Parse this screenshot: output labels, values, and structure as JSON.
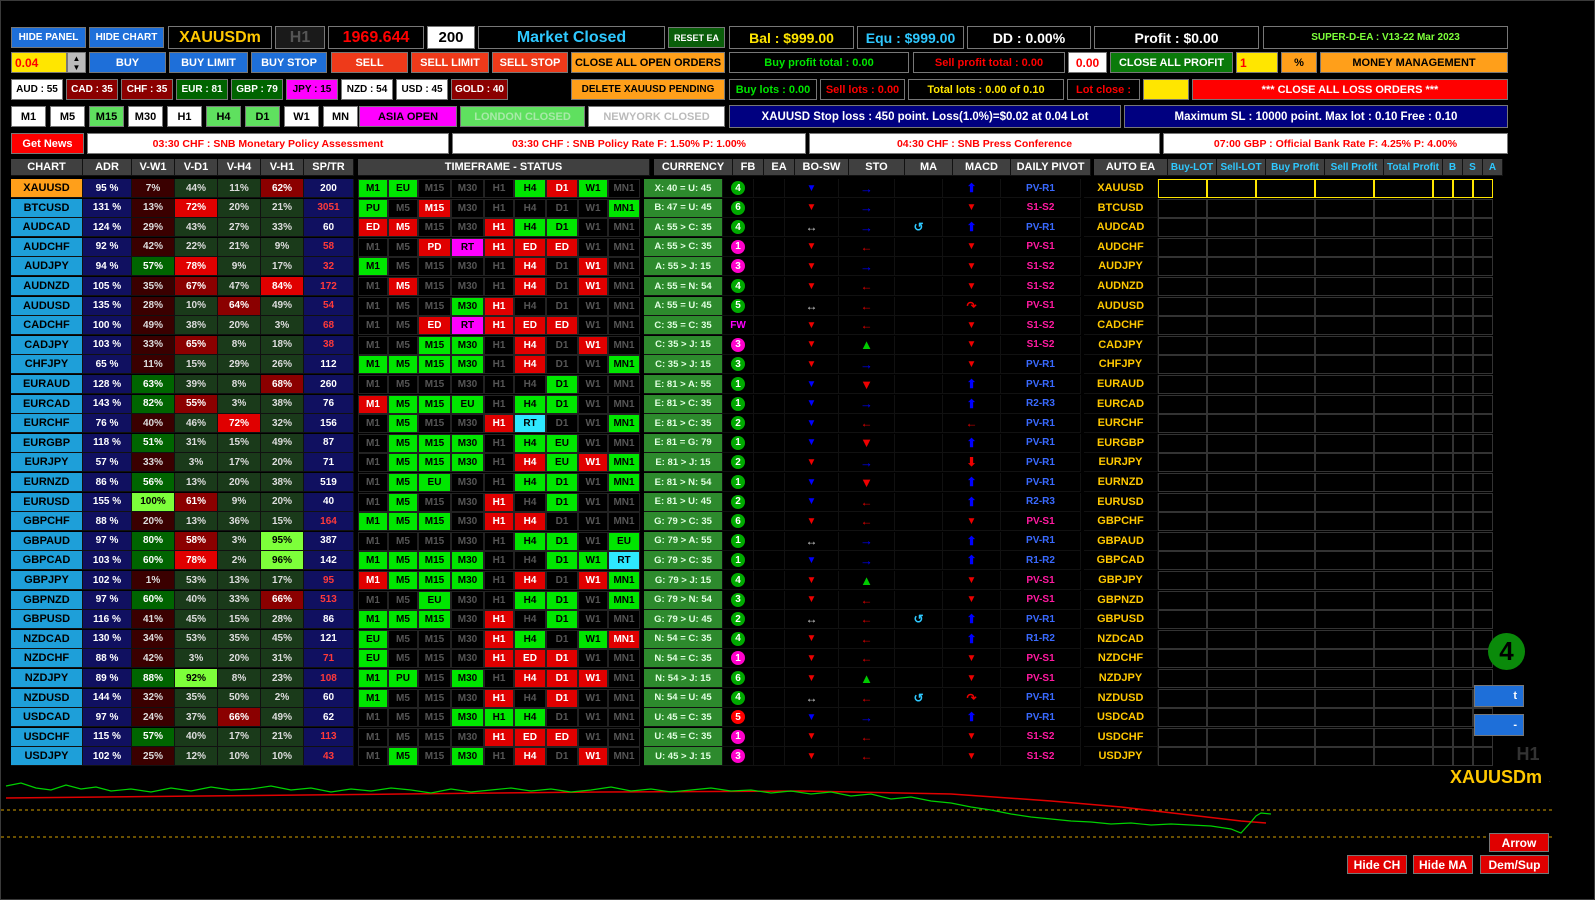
{
  "top": {
    "hide_panel": "HIDE PANEL",
    "hide_chart": "HIDE CHART",
    "symbol": "XAUUSDm",
    "timeframe": "H1",
    "price": "1969.644",
    "bars": "200",
    "market_status": "Market Closed",
    "reset_ea": "RESET EA",
    "balance": "Bal : $999.00",
    "equity": "Equ : $999.00",
    "drawdown": "DD : 0.00%",
    "profit": "Profit : $0.00",
    "version": "SUPER-D-EA : V13-22 Mar 2023"
  },
  "trade": {
    "lot_value": "0.04",
    "buy": "BUY",
    "buy_limit": "BUY LIMIT",
    "buy_stop": "BUY STOP",
    "sell": "SELL",
    "sell_limit": "SELL LIMIT",
    "sell_stop": "SELL STOP",
    "close_all_open": "CLOSE ALL OPEN ORDERS",
    "buy_profit_total": "Buy profit total : 0.00",
    "sell_profit_total": "Sell profit total : 0.00",
    "profit_value": "0.00",
    "close_all_profit": "CLOSE ALL PROFIT",
    "percent_value": "1",
    "percent_label": "%",
    "money_management": "MONEY MANAGEMENT"
  },
  "strength": [
    {
      "label": "AUD : 55",
      "bg": "#ffffff",
      "fg": "#000000"
    },
    {
      "label": "CAD : 35",
      "bg": "#8b0000",
      "fg": "#ffffff"
    },
    {
      "label": "CHF : 35",
      "bg": "#8b0000",
      "fg": "#ffffff"
    },
    {
      "label": "EUR : 81",
      "bg": "#006400",
      "fg": "#ffffff"
    },
    {
      "label": "GBP : 79",
      "bg": "#006400",
      "fg": "#ffffff"
    },
    {
      "label": "JPY : 15",
      "bg": "#ff00ff",
      "fg": "#000000"
    },
    {
      "label": "NZD : 54",
      "bg": "#ffffff",
      "fg": "#000000"
    },
    {
      "label": "USD : 45",
      "bg": "#ffffff",
      "fg": "#000000"
    },
    {
      "label": "GOLD : 40",
      "bg": "#8b0000",
      "fg": "#ffffff"
    }
  ],
  "row3": {
    "delete_pending": "DELETE XAUUSD PENDING",
    "buy_lots": "Buy lots : 0.00",
    "sell_lots": "Sell lots : 0.00",
    "total_lots": "Total lots : 0.00 of 0.10",
    "lot_close": "Lot close :",
    "close_all_loss": "*** CLOSE ALL LOSS ORDERS ***"
  },
  "tf_buttons": [
    "M1",
    "M5",
    "M15",
    "M30",
    "H1",
    "H4",
    "D1",
    "W1",
    "MN"
  ],
  "sessions": {
    "asia": "ASIA OPEN",
    "london": "LONDON CLOSED",
    "newyork": "NEWYORK CLOSED"
  },
  "info": {
    "stop_loss": "XAUUSD Stop loss : 450 point. Loss(1.0%)=$0.02 at 0.04 Lot",
    "max_sl": "Maximum SL : 10000 point. Max lot : 0.10 Free : 0.10"
  },
  "news": {
    "button": "Get News",
    "items": [
      "03:30 CHF : SNB Monetary Policy Assessment",
      "03:30 CHF : SNB Policy Rate  F: 1.50% P: 1.00%",
      "04:30 CHF : SNB Press Conference",
      "07:00 GBP : Official Bank Rate  F: 4.25% P: 4.00%"
    ]
  },
  "headers": {
    "chart": "CHART",
    "adr": "ADR",
    "vw1": "V-W1",
    "vd1": "V-D1",
    "vh4": "V-H4",
    "vh1": "V-H1",
    "sptr": "SP/TR",
    "tfstatus": "TIMEFRAME -  STATUS",
    "currency": "CURRENCY",
    "fb": "FB",
    "ea": "EA",
    "bosw": "BO-SW",
    "sto": "STO",
    "ma": "MA",
    "macd": "MACD",
    "pivot": "DAILY PIVOT",
    "autoea": "AUTO EA",
    "buylot": "Buy-LOT",
    "selllot": "Sell-LOT",
    "buyprofit": "Buy Profit",
    "sellprofit": "Sell Profit",
    "totalprofit": "Total Profit",
    "b": "B",
    "s": "S",
    "a": "A"
  },
  "tf_names": [
    "M1",
    "M5",
    "M15",
    "M30",
    "H1",
    "H4",
    "D1",
    "W1",
    "MN1"
  ],
  "rows": [
    {
      "sym": "XAUUSD",
      "adr": "95 %",
      "vw1": "7%",
      "vd1": "44%",
      "vh4": "11%",
      "vh1": "62%",
      "sp": "200",
      "tf": [
        "g",
        "EU",
        "x",
        "x",
        "x",
        "g",
        "r",
        "g",
        "x"
      ],
      "cur": "X: 40 = U: 45",
      "fb": "4",
      "fbc": "#0a0",
      "bo": "dot",
      "sto": "rb",
      "ma": "",
      "macd": "ub",
      "piv": "PV-R1",
      "pc": "#00f"
    },
    {
      "sym": "BTCUSD",
      "adr": "131 %",
      "vw1": "13%",
      "vd1": "72%",
      "vh4": "20%",
      "vh1": "21%",
      "sp": "3051",
      "tf": [
        "PU",
        "x",
        "r",
        "x",
        "x",
        "x",
        "x",
        "x",
        "g"
      ],
      "cur": "B: 47 = U: 45",
      "fb": "6",
      "fbc": "#0a0",
      "bo": "dr",
      "sto": "rb",
      "ma": "",
      "macd": "dr",
      "piv": "S1-S2",
      "pc": "#f0c"
    },
    {
      "sym": "AUDCAD",
      "adr": "124 %",
      "vw1": "29%",
      "vd1": "43%",
      "vh4": "27%",
      "vh1": "33%",
      "sp": "60",
      "tf": [
        "ED",
        "r",
        "x",
        "x",
        "r",
        "g",
        "g",
        "x",
        "x"
      ],
      "cur": "A: 55 > C: 35",
      "fb": "4",
      "fbc": "#0a0",
      "bo": "lr",
      "sto": "rb",
      "ma": "u",
      "macd": "ub",
      "piv": "PV-R1",
      "pc": "#00f"
    },
    {
      "sym": "AUDCHF",
      "adr": "92 %",
      "vw1": "42%",
      "vd1": "22%",
      "vh4": "21%",
      "vh1": "9%",
      "sp": "58",
      "tf": [
        "x",
        "x",
        "PD",
        "RT",
        "r",
        "ED",
        "ED",
        "x",
        "x"
      ],
      "cur": "A: 55 > C: 35",
      "fb": "1",
      "fbc": "#f0c",
      "bo": "dr",
      "sto": "lr",
      "ma": "",
      "macd": "dr",
      "piv": "PV-S1",
      "pc": "#f0c"
    },
    {
      "sym": "AUDJPY",
      "adr": "94 %",
      "vw1": "57%",
      "vd1": "78%",
      "vh4": "9%",
      "vh1": "17%",
      "sp": "32",
      "tf": [
        "g",
        "x",
        "x",
        "x",
        "x",
        "r",
        "x",
        "r",
        "x"
      ],
      "cur": "A: 55 > J: 15",
      "fb": "3",
      "fbc": "#f0c",
      "bo": "dr",
      "sto": "rb",
      "ma": "",
      "macd": "dr",
      "piv": "S1-S2",
      "pc": "#f0c"
    },
    {
      "sym": "AUDNZD",
      "adr": "105 %",
      "vw1": "35%",
      "vd1": "67%",
      "vh4": "47%",
      "vh1": "84%",
      "sp": "172",
      "tf": [
        "x",
        "r",
        "x",
        "x",
        "x",
        "r",
        "x",
        "r",
        "x"
      ],
      "cur": "A: 55 = N: 54",
      "fb": "4",
      "fbc": "#0a0",
      "bo": "dr",
      "sto": "lr",
      "ma": "",
      "macd": "dr",
      "piv": "S1-S2",
      "pc": "#f0c"
    },
    {
      "sym": "AUDUSD",
      "adr": "135 %",
      "vw1": "28%",
      "vd1": "10%",
      "vh4": "64%",
      "vh1": "49%",
      "sp": "54",
      "tf": [
        "x",
        "x",
        "x",
        "g",
        "r",
        "x",
        "x",
        "x",
        "x"
      ],
      "cur": "A: 55 = U: 45",
      "fb": "5",
      "fbc": "#0a0",
      "bo": "lr",
      "sto": "lr",
      "ma": "",
      "macd": "ar",
      "piv": "PV-S1",
      "pc": "#f0c"
    },
    {
      "sym": "CADCHF",
      "adr": "100 %",
      "vw1": "49%",
      "vd1": "38%",
      "vh4": "20%",
      "vh1": "3%",
      "sp": "68",
      "tf": [
        "x",
        "x",
        "ED",
        "RT",
        "r",
        "ED",
        "ED",
        "x",
        "x"
      ],
      "cur": "C: 35 = C: 35",
      "fb": "FW",
      "fbc": "",
      "bo": "dr",
      "sto": "lr",
      "ma": "",
      "macd": "dr",
      "piv": "S1-S2",
      "pc": "#f0c"
    },
    {
      "sym": "CADJPY",
      "adr": "103 %",
      "vw1": "33%",
      "vd1": "65%",
      "vh4": "8%",
      "vh1": "18%",
      "sp": "38",
      "tf": [
        "x",
        "x",
        "g",
        "g",
        "x",
        "r",
        "x",
        "r",
        "x"
      ],
      "cur": "C: 35 > J: 15",
      "fb": "3",
      "fbc": "#f0c",
      "bo": "dr",
      "sto": "tg",
      "ma": "",
      "macd": "dr",
      "piv": "S1-S2",
      "pc": "#f0c"
    },
    {
      "sym": "CHFJPY",
      "adr": "65 %",
      "vw1": "11%",
      "vd1": "15%",
      "vh4": "29%",
      "vh1": "26%",
      "sp": "112",
      "tf": [
        "g",
        "g",
        "g",
        "g",
        "x",
        "r",
        "x",
        "x",
        "g"
      ],
      "cur": "C: 35 > J: 15",
      "fb": "3",
      "fbc": "#0a0",
      "bo": "dr",
      "sto": "rb",
      "ma": "",
      "macd": "dr",
      "piv": "PV-R1",
      "pc": "#00f"
    },
    {
      "sym": "EURAUD",
      "adr": "128 %",
      "vw1": "63%",
      "vd1": "39%",
      "vh4": "8%",
      "vh1": "68%",
      "sp": "260",
      "tf": [
        "x",
        "x",
        "x",
        "x",
        "x",
        "x",
        "g",
        "x",
        "x"
      ],
      "cur": "E: 81 > A: 55",
      "fb": "1",
      "fbc": "#0a0",
      "bo": "dot",
      "sto": "tr",
      "ma": "",
      "macd": "ub",
      "piv": "PV-R1",
      "pc": "#00f"
    },
    {
      "sym": "EURCAD",
      "adr": "143 %",
      "vw1": "82%",
      "vd1": "55%",
      "vh4": "3%",
      "vh1": "38%",
      "sp": "76",
      "tf": [
        "r",
        "g",
        "g",
        "EU",
        "x",
        "g",
        "g",
        "x",
        "x"
      ],
      "cur": "E: 81 > C: 35",
      "fb": "1",
      "fbc": "#0a0",
      "bo": "dot",
      "sto": "rb",
      "ma": "",
      "macd": "ub",
      "piv": "R2-R3",
      "pc": "#00f"
    },
    {
      "sym": "EURCHF",
      "adr": "76 %",
      "vw1": "40%",
      "vd1": "46%",
      "vh4": "72%",
      "vh1": "32%",
      "sp": "156",
      "tf": [
        "x",
        "g",
        "x",
        "x",
        "r",
        "RT",
        "x",
        "x",
        "g"
      ],
      "cur": "E: 81 > C: 35",
      "fb": "2",
      "fbc": "#0a0",
      "bo": "dot",
      "sto": "lr",
      "ma": "",
      "macd": "lr",
      "piv": "PV-R1",
      "pc": "#00f"
    },
    {
      "sym": "EURGBP",
      "adr": "118 %",
      "vw1": "51%",
      "vd1": "31%",
      "vh4": "15%",
      "vh1": "49%",
      "sp": "87",
      "tf": [
        "x",
        "g",
        "g",
        "g",
        "x",
        "g",
        "EU",
        "x",
        "x"
      ],
      "cur": "E: 81 = G: 79",
      "fb": "1",
      "fbc": "#0a0",
      "bo": "dot",
      "sto": "tr",
      "ma": "",
      "macd": "ub",
      "piv": "PV-R1",
      "pc": "#00f"
    },
    {
      "sym": "EURJPY",
      "adr": "57 %",
      "vw1": "33%",
      "vd1": "3%",
      "vh4": "17%",
      "vh1": "20%",
      "sp": "71",
      "tf": [
        "x",
        "g",
        "g",
        "g",
        "x",
        "r",
        "EU",
        "r",
        "g"
      ],
      "cur": "E: 81 > J: 15",
      "fb": "2",
      "fbc": "#0a0",
      "bo": "dr",
      "sto": "rb",
      "ma": "",
      "macd": "fr",
      "piv": "PV-R1",
      "pc": "#00f"
    },
    {
      "sym": "EURNZD",
      "adr": "86 %",
      "vw1": "56%",
      "vd1": "13%",
      "vh4": "20%",
      "vh1": "38%",
      "sp": "519",
      "tf": [
        "x",
        "g",
        "EU",
        "x",
        "x",
        "g",
        "g",
        "x",
        "g"
      ],
      "cur": "E: 81 > N: 54",
      "fb": "1",
      "fbc": "#0a0",
      "bo": "dot",
      "sto": "tr",
      "ma": "",
      "macd": "ub",
      "piv": "PV-R1",
      "pc": "#00f"
    },
    {
      "sym": "EURUSD",
      "adr": "155 %",
      "vw1": "100%",
      "vd1": "61%",
      "vh4": "9%",
      "vh1": "20%",
      "sp": "40",
      "tf": [
        "x",
        "g",
        "x",
        "x",
        "r",
        "x",
        "g",
        "x",
        "x"
      ],
      "cur": "E: 81 > U: 45",
      "fb": "2",
      "fbc": "#0a0",
      "bo": "dot",
      "sto": "lr",
      "ma": "",
      "macd": "ub",
      "piv": "R2-R3",
      "pc": "#00f"
    },
    {
      "sym": "GBPCHF",
      "adr": "88 %",
      "vw1": "20%",
      "vd1": "13%",
      "vh4": "36%",
      "vh1": "15%",
      "sp": "164",
      "tf": [
        "g",
        "g",
        "g",
        "x",
        "r",
        "r",
        "x",
        "x",
        "x"
      ],
      "cur": "G: 79 > C: 35",
      "fb": "6",
      "fbc": "#0a0",
      "bo": "dr",
      "sto": "lr",
      "ma": "",
      "macd": "dr",
      "piv": "PV-S1",
      "pc": "#f0c"
    },
    {
      "sym": "GBPAUD",
      "adr": "97 %",
      "vw1": "80%",
      "vd1": "58%",
      "vh4": "3%",
      "vh1": "95%",
      "sp": "387",
      "tf": [
        "x",
        "x",
        "x",
        "x",
        "x",
        "g",
        "g",
        "x",
        "EU"
      ],
      "cur": "G: 79 > A: 55",
      "fb": "1",
      "fbc": "#0a0",
      "bo": "lr",
      "sto": "rb",
      "ma": "",
      "macd": "ub",
      "piv": "PV-R1",
      "pc": "#00f"
    },
    {
      "sym": "GBPCAD",
      "adr": "103 %",
      "vw1": "60%",
      "vd1": "78%",
      "vh4": "2%",
      "vh1": "96%",
      "sp": "142",
      "tf": [
        "g",
        "g",
        "g",
        "g",
        "x",
        "x",
        "g",
        "g",
        "RT"
      ],
      "cur": "G: 79 > C: 35",
      "fb": "1",
      "fbc": "#0a0",
      "bo": "dot",
      "sto": "rb",
      "ma": "",
      "macd": "ub",
      "piv": "R1-R2",
      "pc": "#00f"
    },
    {
      "sym": "GBPJPY",
      "adr": "102 %",
      "vw1": "1%",
      "vd1": "53%",
      "vh4": "13%",
      "vh1": "17%",
      "sp": "95",
      "tf": [
        "r",
        "g",
        "g",
        "g",
        "x",
        "r",
        "x",
        "r",
        "g"
      ],
      "cur": "G: 79 > J: 15",
      "fb": "4",
      "fbc": "#0a0",
      "bo": "dr",
      "sto": "tg",
      "ma": "",
      "macd": "dr",
      "piv": "PV-S1",
      "pc": "#f0c"
    },
    {
      "sym": "GBPNZD",
      "adr": "97 %",
      "vw1": "60%",
      "vd1": "40%",
      "vh4": "33%",
      "vh1": "66%",
      "sp": "513",
      "tf": [
        "x",
        "x",
        "EU",
        "x",
        "x",
        "g",
        "g",
        "x",
        "g"
      ],
      "cur": "G: 79 > N: 54",
      "fb": "3",
      "fbc": "#0a0",
      "bo": "dr",
      "sto": "lr",
      "ma": "",
      "macd": "dr",
      "piv": "PV-S1",
      "pc": "#f0c"
    },
    {
      "sym": "GBPUSD",
      "adr": "116 %",
      "vw1": "41%",
      "vd1": "45%",
      "vh4": "15%",
      "vh1": "28%",
      "sp": "86",
      "tf": [
        "g",
        "g",
        "g",
        "x",
        "r",
        "x",
        "g",
        "x",
        "x"
      ],
      "cur": "G: 79 > U: 45",
      "fb": "2",
      "fbc": "#0a0",
      "bo": "lr",
      "sto": "lr",
      "ma": "u",
      "macd": "ub",
      "piv": "PV-R1",
      "pc": "#00f"
    },
    {
      "sym": "NZDCAD",
      "adr": "130 %",
      "vw1": "34%",
      "vd1": "53%",
      "vh4": "35%",
      "vh1": "45%",
      "sp": "121",
      "tf": [
        "EU",
        "x",
        "x",
        "x",
        "r",
        "g",
        "x",
        "g",
        "MNr"
      ],
      "cur": "N: 54 = C: 35",
      "fb": "4",
      "fbc": "#0a0",
      "bo": "dr",
      "sto": "lr",
      "ma": "",
      "macd": "ub",
      "piv": "R1-R2",
      "pc": "#00f"
    },
    {
      "sym": "NZDCHF",
      "adr": "88 %",
      "vw1": "42%",
      "vd1": "3%",
      "vh4": "20%",
      "vh1": "31%",
      "sp": "71",
      "tf": [
        "EU",
        "x",
        "x",
        "x",
        "r",
        "ED",
        "r",
        "x",
        "x"
      ],
      "cur": "N: 54 = C: 35",
      "fb": "1",
      "fbc": "#f0c",
      "bo": "dr",
      "sto": "lr",
      "ma": "",
      "macd": "dr",
      "piv": "PV-S1",
      "pc": "#f0c"
    },
    {
      "sym": "NZDJPY",
      "adr": "89 %",
      "vw1": "88%",
      "vd1": "92%",
      "vh4": "8%",
      "vh1": "23%",
      "sp": "108",
      "tf": [
        "g",
        "PU",
        "x",
        "g",
        "x",
        "r",
        "r",
        "r",
        "x"
      ],
      "cur": "N: 54 > J: 15",
      "fb": "6",
      "fbc": "#0a0",
      "bo": "dr",
      "sto": "tg",
      "ma": "",
      "macd": "dr",
      "piv": "PV-S1",
      "pc": "#f0c"
    },
    {
      "sym": "NZDUSD",
      "adr": "144 %",
      "vw1": "32%",
      "vd1": "35%",
      "vh4": "50%",
      "vh1": "2%",
      "sp": "60",
      "tf": [
        "g",
        "x",
        "x",
        "x",
        "r",
        "x",
        "r",
        "x",
        "x"
      ],
      "cur": "N: 54 = U: 45",
      "fb": "4",
      "fbc": "#0a0",
      "bo": "lr",
      "sto": "lr",
      "ma": "u",
      "macd": "ar",
      "piv": "PV-R1",
      "pc": "#00f"
    },
    {
      "sym": "USDCAD",
      "adr": "97 %",
      "vw1": "24%",
      "vd1": "37%",
      "vh4": "66%",
      "vh1": "49%",
      "sp": "62",
      "tf": [
        "x",
        "x",
        "x",
        "g",
        "g",
        "g",
        "x",
        "x",
        "x"
      ],
      "cur": "U: 45 = C: 35",
      "fb": "5",
      "fbc": "#f00",
      "bo": "dot",
      "sto": "rb",
      "ma": "",
      "macd": "ub",
      "piv": "PV-R1",
      "pc": "#00f"
    },
    {
      "sym": "USDCHF",
      "adr": "115 %",
      "vw1": "57%",
      "vd1": "40%",
      "vh4": "17%",
      "vh1": "21%",
      "sp": "113",
      "tf": [
        "x",
        "x",
        "x",
        "x",
        "r",
        "ED",
        "ED",
        "x",
        "x"
      ],
      "cur": "U: 45 = C: 35",
      "fb": "1",
      "fbc": "#f0c",
      "bo": "dr",
      "sto": "lr",
      "ma": "",
      "macd": "dr",
      "piv": "S1-S2",
      "pc": "#f0c"
    },
    {
      "sym": "USDJPY",
      "adr": "102 %",
      "vw1": "25%",
      "vd1": "12%",
      "vh4": "10%",
      "vh1": "10%",
      "sp": "43",
      "tf": [
        "x",
        "g",
        "x",
        "g",
        "x",
        "r",
        "x",
        "r",
        "x"
      ],
      "cur": "U: 45 > J: 15",
      "fb": "3",
      "fbc": "#f0c",
      "bo": "dr",
      "sto": "lr",
      "ma": "",
      "macd": "dr",
      "piv": "S1-S2",
      "pc": "#f0c"
    }
  ],
  "chart": {
    "big_number": "4",
    "tf_label": "H1",
    "symbol_label": "XAUUSDm",
    "btn_partial_1": "t",
    "btn_partial_2": "-",
    "arrow": "Arrow",
    "hide_ch": "Hide CH",
    "hide_ma": "Hide MA",
    "dem_sup": "Dem/Sup"
  }
}
